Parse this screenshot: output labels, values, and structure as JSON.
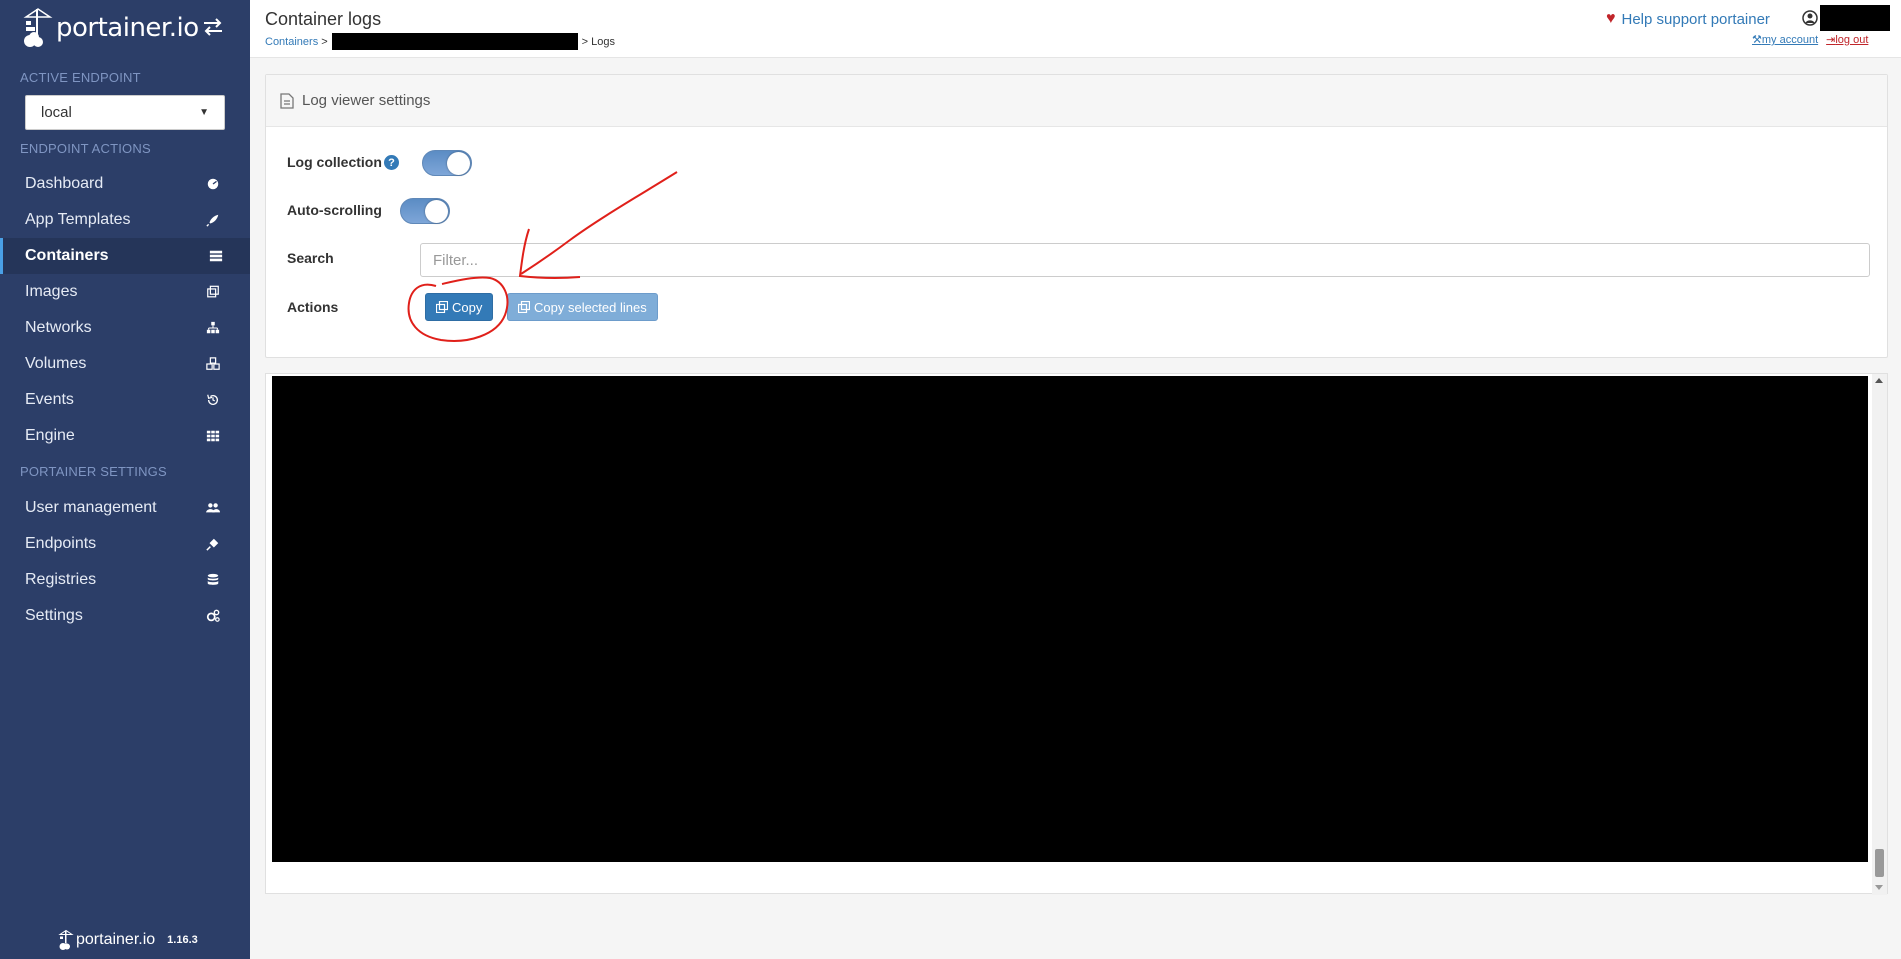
{
  "brand": {
    "name": "portainer.io"
  },
  "sidebar": {
    "active_endpoint_heading": "ACTIVE ENDPOINT",
    "endpoint_value": "local",
    "endpoint_actions_heading": "ENDPOINT ACTIONS",
    "endpoint_items": [
      {
        "label": "Dashboard",
        "icon": "dashboard-icon"
      },
      {
        "label": "App Templates",
        "icon": "rocket-icon"
      },
      {
        "label": "Containers",
        "icon": "server-icon",
        "active": true
      },
      {
        "label": "Images",
        "icon": "clone-icon"
      },
      {
        "label": "Networks",
        "icon": "sitemap-icon"
      },
      {
        "label": "Volumes",
        "icon": "cubes-icon"
      },
      {
        "label": "Events",
        "icon": "history-icon"
      },
      {
        "label": "Engine",
        "icon": "th-icon"
      }
    ],
    "portainer_settings_heading": "PORTAINER SETTINGS",
    "settings_items": [
      {
        "label": "User management",
        "icon": "users-icon"
      },
      {
        "label": "Endpoints",
        "icon": "plug-icon"
      },
      {
        "label": "Registries",
        "icon": "database-icon"
      },
      {
        "label": "Settings",
        "icon": "cogs-icon"
      }
    ],
    "footer": {
      "logo": "portainer.io",
      "version": "1.16.3"
    }
  },
  "header": {
    "title": "Container logs",
    "breadcrumb": {
      "root": "Containers",
      "sep1": ">",
      "sep2": "> Logs"
    },
    "help_support": "Help support portainer",
    "my_account": "my account",
    "log_out": "log out"
  },
  "settings_panel": {
    "title": "Log viewer settings",
    "log_collection_label": "Log collection",
    "help_glyph": "?",
    "log_collection_on": true,
    "auto_scrolling_label": "Auto-scrolling",
    "auto_scrolling_on": true,
    "search_label": "Search",
    "search_placeholder": "Filter...",
    "actions_label": "Actions",
    "copy_label": "Copy",
    "copy_selected_label": "Copy selected lines"
  },
  "colors": {
    "sidebar_bg": "#2c3e68",
    "primary": "#337ab7",
    "annotation": "#e0201a"
  }
}
